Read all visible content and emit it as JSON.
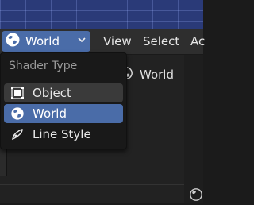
{
  "header": {
    "editor_label": "World",
    "menus": [
      "View",
      "Select",
      "Ac"
    ]
  },
  "dropdown": {
    "title": "Shader Type",
    "items": [
      {
        "label": "Object",
        "icon": "object-icon",
        "state": "hover"
      },
      {
        "label": "World",
        "icon": "world-icon",
        "state": "active"
      },
      {
        "label": "Line Style",
        "icon": "line-style-icon",
        "state": "normal"
      }
    ]
  },
  "node": {
    "label": "World"
  },
  "colors": {
    "accent": "#4a6ca8",
    "menu_bg": "#191919",
    "header_bg": "#2e2e2e"
  }
}
